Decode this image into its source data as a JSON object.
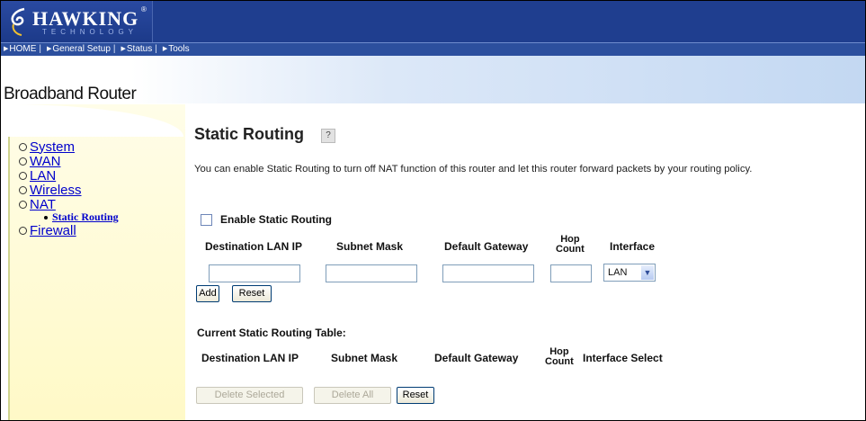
{
  "header": {
    "logo_text": "HAWKING",
    "logo_sub": "TECHNOLOGY",
    "logo_reg": "®"
  },
  "nav": {
    "items": [
      {
        "label": "HOME"
      },
      {
        "label": "General Setup"
      },
      {
        "label": "Status"
      },
      {
        "label": "Tools"
      }
    ],
    "separator": "|"
  },
  "product_name": "Broadband Router",
  "sidebar": {
    "items": [
      {
        "label": "System"
      },
      {
        "label": "WAN"
      },
      {
        "label": "LAN"
      },
      {
        "label": "Wireless"
      },
      {
        "label": "NAT"
      },
      {
        "label": "Firewall"
      }
    ],
    "sub_item": "Static Routing"
  },
  "page": {
    "title": "Static Routing",
    "help_icon": "?",
    "description": "You can enable Static Routing to turn off NAT function of this router and let this router forward packets by your routing policy.",
    "enable_label": "Enable Static Routing",
    "columns": {
      "dest": "Destination LAN IP",
      "mask": "Subnet Mask",
      "gateway": "Default Gateway",
      "hop_line1": "Hop",
      "hop_line2": "Count",
      "interface": "Interface"
    },
    "interface_value": "LAN",
    "add_label": "Add",
    "reset_label": "Reset",
    "table_title": "Current Static Routing Table:",
    "table_columns": {
      "dest": "Destination LAN IP",
      "mask": "Subnet Mask",
      "gateway": "Default Gateway",
      "hop_line1": "Hop",
      "hop_line2": "Count",
      "select": "Interface Select"
    },
    "delete_selected_label": "Delete Selected",
    "delete_all_label": "Delete All",
    "reset2_label": "Reset"
  },
  "colors": {
    "header_blue": "#1f3e8f",
    "nav_blue": "#2c4f9e",
    "link_blue": "#0000cc",
    "sidebar_yellow": "#fff9c7"
  }
}
